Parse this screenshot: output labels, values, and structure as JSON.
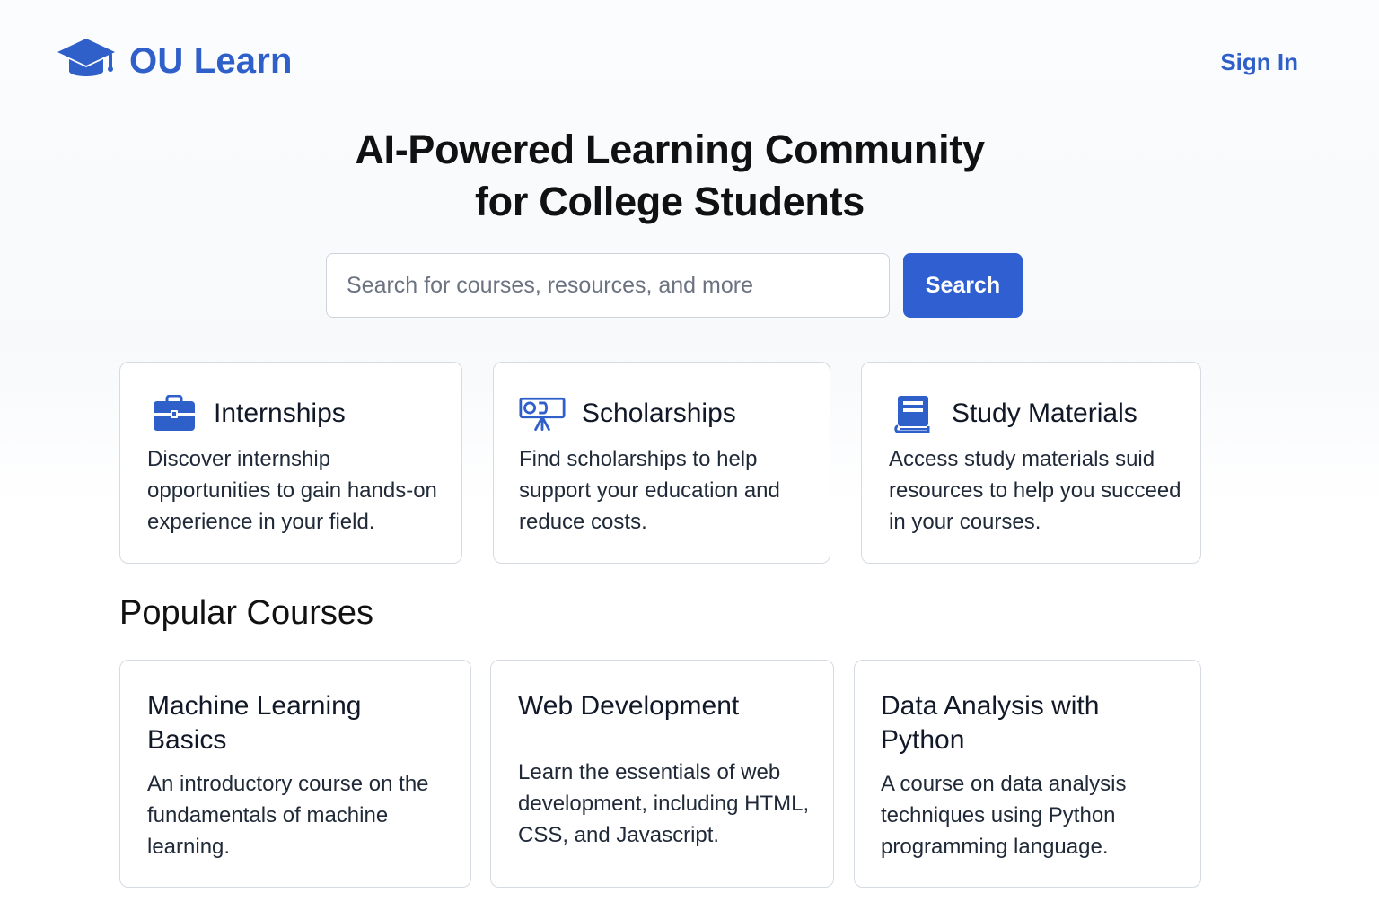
{
  "header": {
    "logo_icon": "graduation-cap-icon",
    "logo_text": "OU Learn",
    "signin_label": "Sign In"
  },
  "hero": {
    "title_line1": "AI-Powered Learning Community",
    "title_line2": "for College Students"
  },
  "search": {
    "placeholder": "Search for courses, resources, and more",
    "value": "",
    "button_label": "Search"
  },
  "features": [
    {
      "icon": "briefcase-icon",
      "title": "Internships",
      "description": "Discover internship opportunities to gain hands-on experience in your field."
    },
    {
      "icon": "scholarship-presentation-icon",
      "title": "Scholarships",
      "description": "Find scholarships to help support your education and reduce costs."
    },
    {
      "icon": "book-icon",
      "title": "Study Materials",
      "description": "Access study materials suid resources to help you succeed in your courses."
    }
  ],
  "popular": {
    "heading": "Popular Courses",
    "courses": [
      {
        "title": "Machine Learning Basics",
        "description": "An introductory course on the fundamentals of machine learning."
      },
      {
        "title": "Web Development",
        "description": "Learn the essentials of web development, including HTML, CSS, and Javascript."
      },
      {
        "title": "Data Analysis with Python",
        "description": "A course on data analysis techniques using Python programming language."
      }
    ]
  },
  "colors": {
    "brand": "#2f5fc9",
    "button": "#2f5fd0",
    "card_border": "#d6dbe2",
    "text": "#111827"
  }
}
